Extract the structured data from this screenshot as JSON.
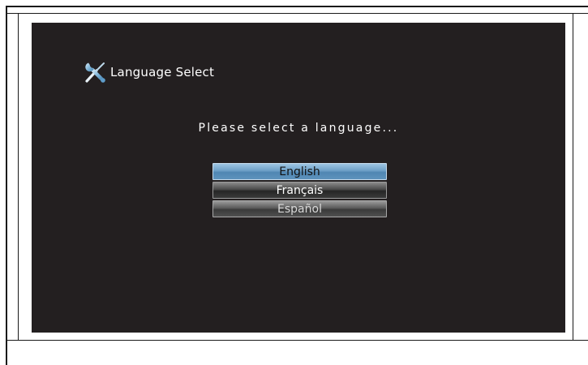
{
  "screen": {
    "header": {
      "icon": "wrench-screwdriver-icon",
      "title": "Language Select"
    },
    "prompt": "Please select a language...",
    "languages": [
      {
        "label": "English",
        "state": "selected"
      },
      {
        "label": "Français",
        "state": "normal"
      },
      {
        "label": "Español",
        "state": "normal"
      }
    ]
  },
  "colors": {
    "screen_background": "#231f20",
    "selected_highlight": "#6d9fc6",
    "text": "#ffffff"
  }
}
